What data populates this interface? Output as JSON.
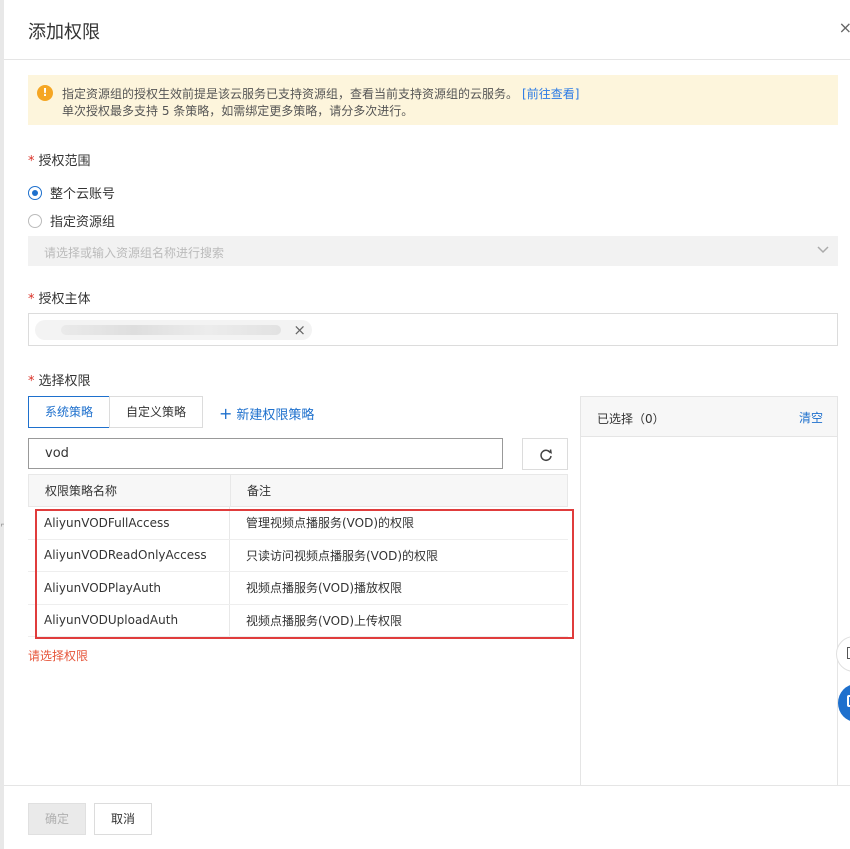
{
  "dialog": {
    "title": "添加权限",
    "close_glyph": "×"
  },
  "alert": {
    "line1": "指定资源组的授权生效前提是该云服务已支持资源组，查看当前支持资源组的云服务。",
    "link": "[前往查看]",
    "line2": "单次授权最多支持 5 条策略，如需绑定更多策略，请分多次进行。"
  },
  "scope": {
    "label": "授权范围",
    "options": [
      "整个云账号",
      "指定资源组"
    ],
    "selected": "整个云账号",
    "resource_group_placeholder": "请选择或输入资源组名称进行搜索"
  },
  "principal": {
    "label": "授权主体",
    "tag_remove_glyph": "×"
  },
  "permissions": {
    "label": "选择权限",
    "tabs": [
      "系统策略",
      "自定义策略"
    ],
    "active_tab": "系统策略",
    "new_policy": "新建权限策略",
    "search_value": "vod",
    "columns": [
      "权限策略名称",
      "备注"
    ],
    "rows": [
      {
        "name": "AliyunVODFullAccess",
        "note": "管理视频点播服务(VOD)的权限"
      },
      {
        "name": "AliyunVODReadOnlyAccess",
        "note": "只读访问视频点播服务(VOD)的权限"
      },
      {
        "name": "AliyunVODPlayAuth",
        "note": "视频点播服务(VOD)播放权限"
      },
      {
        "name": "AliyunVODUploadAuth",
        "note": "视频点播服务(VOD)上传权限"
      }
    ],
    "error": "请选择权限"
  },
  "selected_panel": {
    "title": "已选择（0）",
    "clear": "清空"
  },
  "footer": {
    "ok": "确定",
    "cancel": "取消"
  },
  "colors": {
    "accent": "#1e70cd",
    "error": "#e03c3c",
    "alert_bg": "#fdf5dc"
  }
}
